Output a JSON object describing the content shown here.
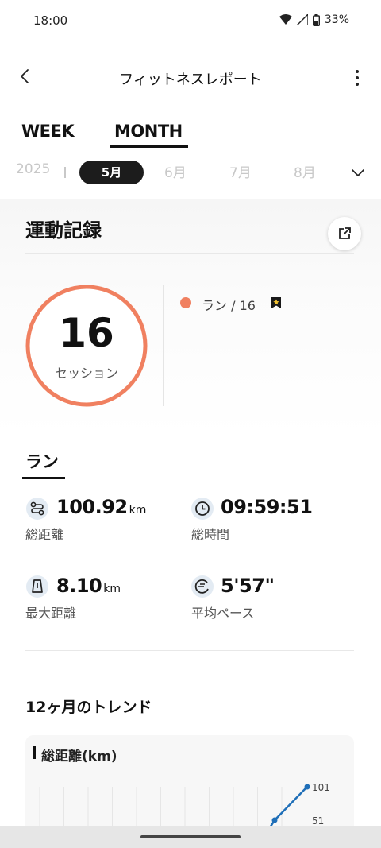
{
  "status": {
    "time": "18:00",
    "battery": "33%"
  },
  "header": {
    "title": "フィットネスレポート"
  },
  "tabs": [
    {
      "label": "WEEK"
    },
    {
      "label": "MONTH"
    }
  ],
  "months": {
    "year": "2025",
    "selected": "5月",
    "others": [
      "6月",
      "7月",
      "8月"
    ]
  },
  "activity": {
    "title": "運動記録",
    "sessions": "16",
    "sessions_label": "セッション",
    "legend": "ラン / 16"
  },
  "run": {
    "title": "ラン",
    "stats": [
      {
        "icon": "route-icon",
        "value": "100.92",
        "unit": "km",
        "label": "総距離"
      },
      {
        "icon": "clock-icon",
        "value": "09:59:51",
        "unit": "",
        "label": "総時間"
      },
      {
        "icon": "shoe-icon",
        "value": "8.10",
        "unit": "km",
        "label": "最大距離"
      },
      {
        "icon": "pace-icon",
        "value": "5'57\"",
        "unit": "",
        "label": "平均ペース"
      }
    ]
  },
  "trend": {
    "title": "12ヶ月のトレンド",
    "chart_title": "総距離(km)"
  },
  "chart_data": {
    "type": "line",
    "title": "総距離(km)",
    "y_ticks": [
      101,
      51
    ],
    "points_visible": [
      51,
      101
    ],
    "series_color": "#1f6fb8"
  },
  "colors": {
    "ring": "#f08060",
    "accent_line": "#1f6fb8"
  }
}
